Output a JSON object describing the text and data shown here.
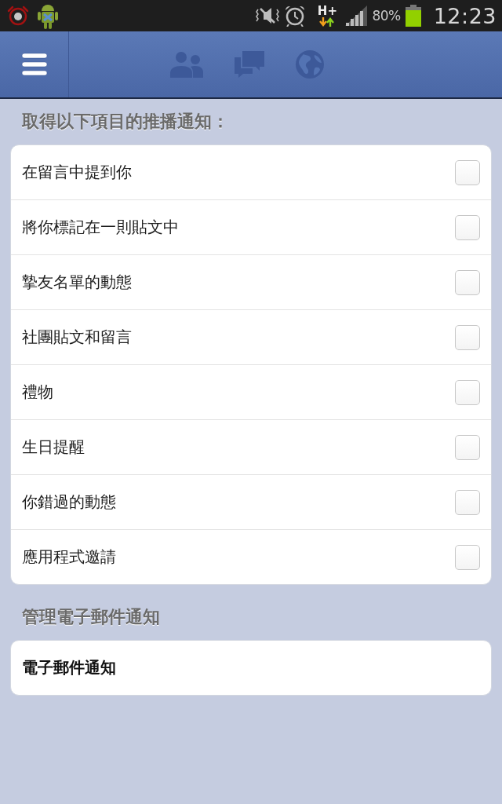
{
  "status_bar": {
    "network": "H+",
    "battery": "80%",
    "time": "12:23"
  },
  "push_section": {
    "heading": "取得以下項目的推播通知：",
    "items": [
      {
        "label": "在留言中提到你",
        "checked": false
      },
      {
        "label": "將你標記在一則貼文中",
        "checked": false
      },
      {
        "label": "摯友名單的動態",
        "checked": false
      },
      {
        "label": "社團貼文和留言",
        "checked": false
      },
      {
        "label": "禮物",
        "checked": false
      },
      {
        "label": "生日提醒",
        "checked": false
      },
      {
        "label": "你錯過的動態",
        "checked": false
      },
      {
        "label": "應用程式邀請",
        "checked": false
      }
    ]
  },
  "email_section": {
    "heading": "管理電子郵件通知",
    "items": [
      {
        "label": "電子郵件通知"
      }
    ]
  }
}
